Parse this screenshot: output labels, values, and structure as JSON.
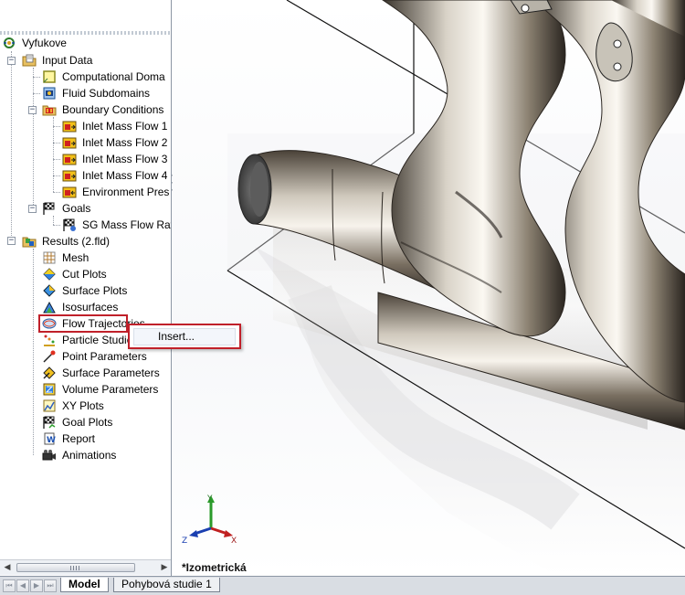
{
  "tree": {
    "project": "Vyfukove",
    "input_data": "Input Data",
    "computational_domain": "Computational Doma",
    "fluid_subdomains": "Fluid Subdomains",
    "boundary_conditions": "Boundary Conditions",
    "inlet_1": "Inlet Mass Flow 1",
    "inlet_2": "Inlet Mass Flow 2",
    "inlet_3": "Inlet Mass Flow 3",
    "inlet_4": "Inlet Mass Flow 4",
    "environment_pressure": "Environment Pres",
    "goals": "Goals",
    "sg_mass_flow": "SG Mass Flow Rat",
    "results": "Results (2.fld)",
    "mesh": "Mesh",
    "cut_plots": "Cut Plots",
    "surface_plots": "Surface Plots",
    "isosurfaces": "Isosurfaces",
    "flow_trajectories": "Flow Trajectories",
    "particle_studies": "Particle Studies",
    "point_parameters": "Point Parameters",
    "surface_parameters": "Surface Parameters",
    "volume_parameters": "Volume Parameters",
    "xy_plots": "XY Plots",
    "goal_plots": "Goal Plots",
    "report": "Report",
    "animations": "Animations"
  },
  "context_menu": {
    "insert": "Insert..."
  },
  "viewport": {
    "view_label": "*Izometrická"
  },
  "triad": {
    "x": "X",
    "y": "Y",
    "z": "Z"
  },
  "tabs": {
    "model": "Model",
    "motion_study": "Pohybová studie 1"
  },
  "colors": {
    "highlight": "#c0202a",
    "pipe_metal": "#8a8070"
  }
}
